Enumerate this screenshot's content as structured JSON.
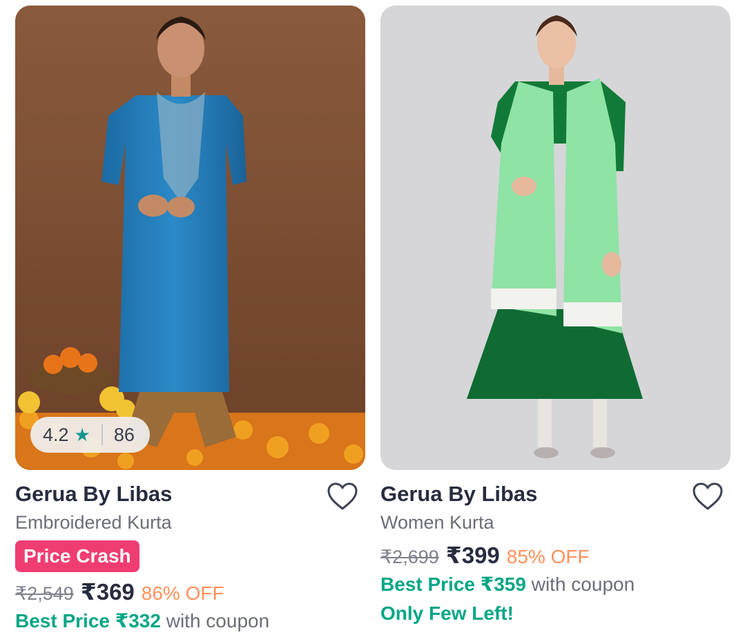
{
  "products": [
    {
      "rating": "4.2",
      "rating_count": "86",
      "brand": "Gerua By Libas",
      "title": "Embroidered Kurta",
      "badge": "Price Crash",
      "mrp": "₹2,549",
      "price": "₹369",
      "discount": "86% OFF",
      "best_price": "Best Price ₹332",
      "best_suffix": " with coupon"
    },
    {
      "brand": "Gerua By Libas",
      "title": "Women Kurta",
      "mrp": "₹2,699",
      "price": "₹399",
      "discount": "85% OFF",
      "best_price": "Best Price ₹359",
      "best_suffix": " with coupon",
      "stock_note": "Only Few Left!"
    }
  ],
  "icons": {
    "rating": "star-icon",
    "wishlist": "heart-outline-icon"
  },
  "colors": {
    "badge": "#ef3d72",
    "discount": "#ff905a",
    "best_price": "#03a685",
    "star": "#14958f"
  }
}
